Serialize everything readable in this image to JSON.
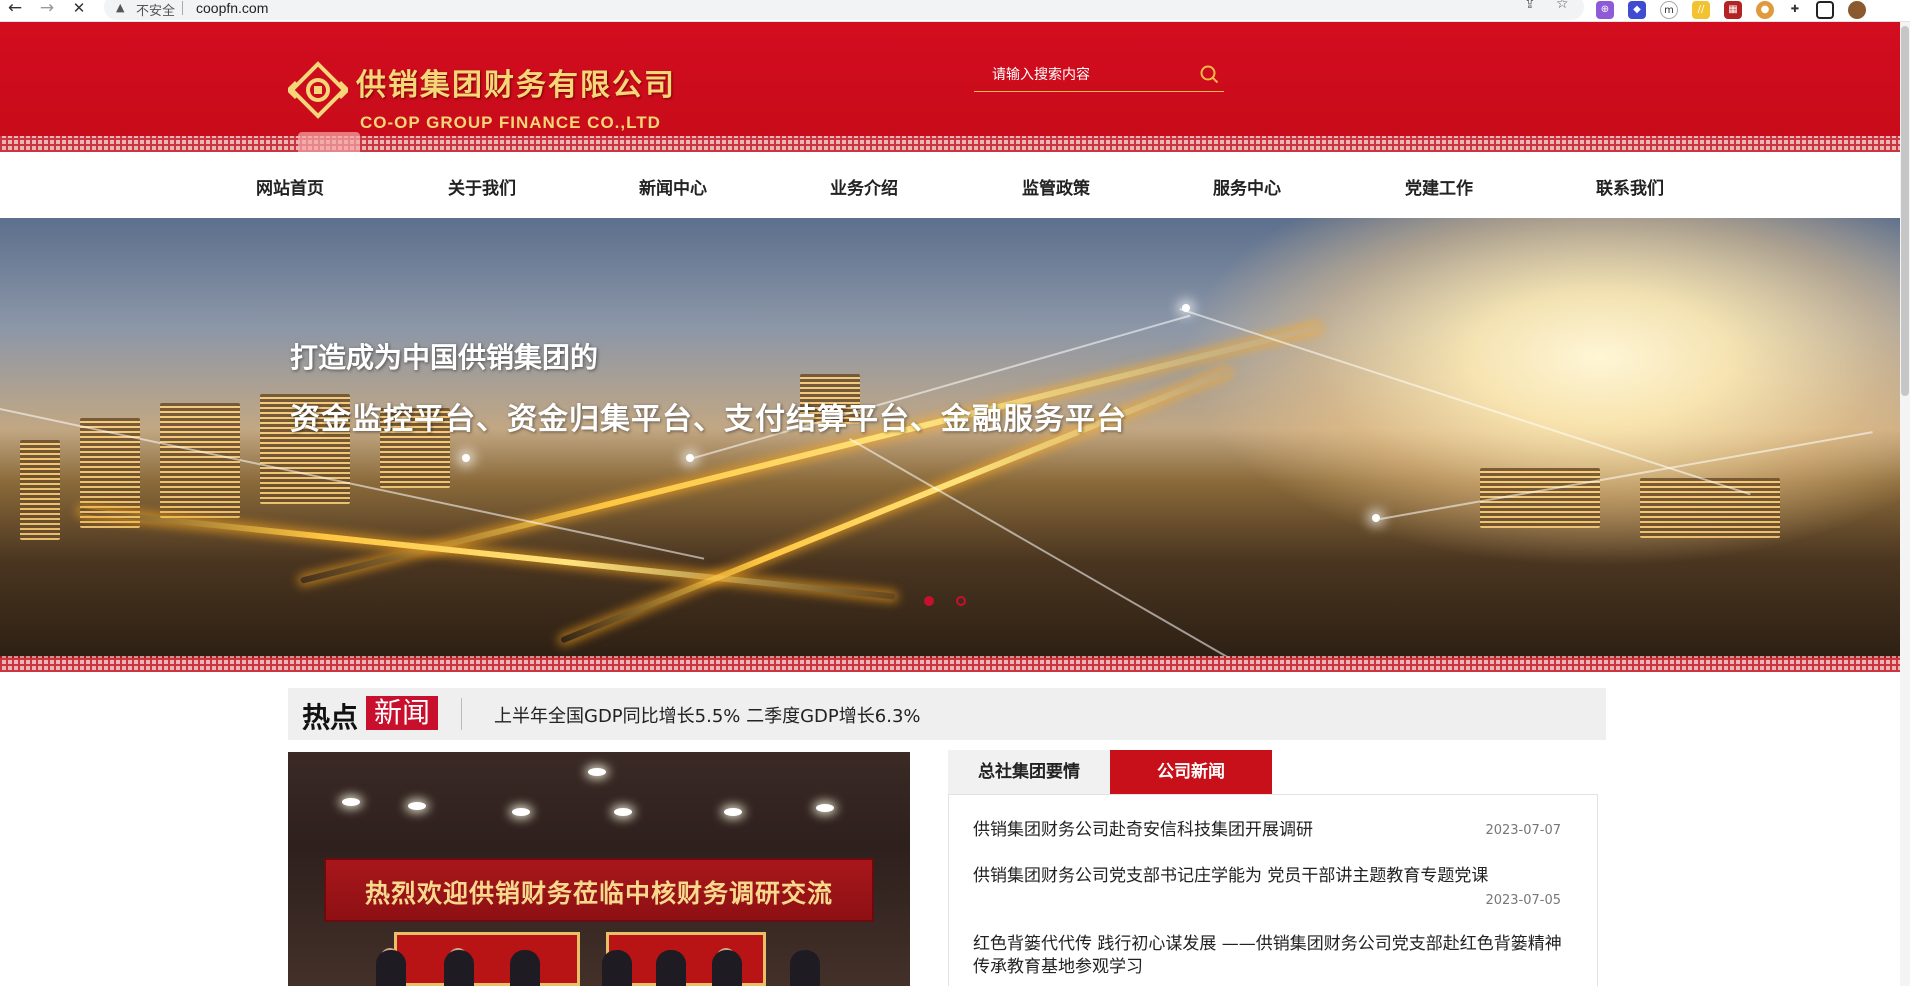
{
  "browser": {
    "back_icon": "←",
    "forward_icon": "→",
    "stop_icon": "✕",
    "security_label": "不安全",
    "url": "coopfn.com"
  },
  "header": {
    "logo_cn": "供销集团财务有限公司",
    "logo_en": "CO-OP GROUP FINANCE CO.,LTD",
    "search_placeholder": "请输入搜索内容",
    "brand_color": "#c80b1a",
    "gold_color": "#f5d77a"
  },
  "nav": {
    "items": [
      "网站首页",
      "关于我们",
      "新闻中心",
      "业务介绍",
      "监管政策",
      "服务中心",
      "党建工作",
      "联系我们"
    ]
  },
  "banner": {
    "title": "打造成为中国供销集团的",
    "subtitle": "资金监控平台、资金归集平台、支付结算平台、金融服务平台"
  },
  "hot_news": {
    "label_a": "热点",
    "label_b": "新闻",
    "headline": "上半年全国GDP同比增长5.5% 二季度GDP增长6.3%"
  },
  "photo": {
    "banner_text": "热烈欢迎供销财务莅临中核财务调研交流"
  },
  "news_tabs": {
    "tab_inactive": "总社集团要情",
    "tab_active": "公司新闻"
  },
  "news_list": [
    {
      "title": "供销集团财务公司赴奇安信科技集团开展调研",
      "date": "2023-07-07"
    },
    {
      "title": "供销集团财务公司党支部书记庄学能为 党员干部讲主题教育专题党课",
      "date": "2023-07-05"
    },
    {
      "title": "红色背篓代代传 践行初心谋发展 ——供销集团财务公司党支部赴红色背篓精神传承教育基地参观学习",
      "date": ""
    }
  ]
}
